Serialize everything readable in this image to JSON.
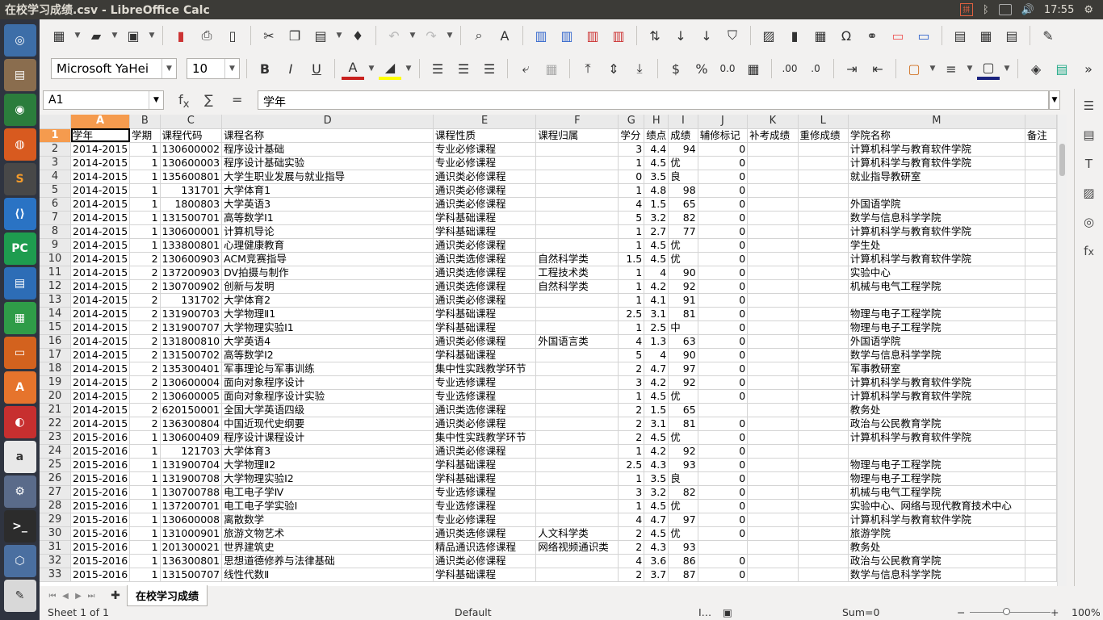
{
  "window": {
    "title": "在校学习成绩.csv - LibreOffice Calc"
  },
  "tray": {
    "time": "17:55"
  },
  "launcher": [
    "dash",
    "files",
    "chrome",
    "firefox",
    "sublime",
    "vscode",
    "pycharm",
    "writer",
    "calc",
    "impress",
    "software-center",
    "netease-music",
    "amazon",
    "settings",
    "terminal",
    "box",
    "editor"
  ],
  "toolbar2": {
    "font_name": "Microsoft YaHei",
    "font_size": "10"
  },
  "formula": {
    "cell_ref": "A1",
    "content": "学年"
  },
  "columns": [
    "A",
    "B",
    "C",
    "D",
    "E",
    "F",
    "G",
    "H",
    "I",
    "J",
    "K",
    "L",
    "M",
    ""
  ],
  "headers": [
    "学年",
    "学期",
    "课程代码",
    "课程名称",
    "课程性质",
    "课程归属",
    "学分",
    "绩点",
    "成绩",
    "辅修标记",
    "补考成绩",
    "重修成绩",
    "学院名称",
    "备注"
  ],
  "rows": [
    [
      "2014-2015",
      "1",
      "130600002",
      "程序设计基础",
      "专业必修课程",
      "",
      "3",
      "4.4",
      "94",
      "0",
      "",
      "",
      "计算机科学与教育软件学院",
      ""
    ],
    [
      "2014-2015",
      "1",
      "130600003",
      "程序设计基础实验",
      "专业必修课程",
      "",
      "1",
      "4.5",
      "优",
      "0",
      "",
      "",
      "计算机科学与教育软件学院",
      ""
    ],
    [
      "2014-2015",
      "1",
      "135600801",
      "大学生职业发展与就业指导",
      "通识类必修课程",
      "",
      "0",
      "3.5",
      "良",
      "0",
      "",
      "",
      "就业指导教研室",
      ""
    ],
    [
      "2014-2015",
      "1",
      "131701",
      "大学体育1",
      "通识类必修课程",
      "",
      "1",
      "4.8",
      "98",
      "0",
      "",
      "",
      "",
      ""
    ],
    [
      "2014-2015",
      "1",
      "1800803",
      "大学英语3",
      "通识类必修课程",
      "",
      "4",
      "1.5",
      "65",
      "0",
      "",
      "",
      "外国语学院",
      ""
    ],
    [
      "2014-2015",
      "1",
      "131500701",
      "高等数学Ⅰ1",
      "学科基础课程",
      "",
      "5",
      "3.2",
      "82",
      "0",
      "",
      "",
      "数学与信息科学学院",
      ""
    ],
    [
      "2014-2015",
      "1",
      "130600001",
      "计算机导论",
      "学科基础课程",
      "",
      "1",
      "2.7",
      "77",
      "0",
      "",
      "",
      "计算机科学与教育软件学院",
      ""
    ],
    [
      "2014-2015",
      "1",
      "133800801",
      "心理健康教育",
      "通识类必修课程",
      "",
      "1",
      "4.5",
      "优",
      "0",
      "",
      "",
      "学生处",
      ""
    ],
    [
      "2014-2015",
      "2",
      "130600903",
      "ACM竞赛指导",
      "通识类选修课程",
      "自然科学类",
      "1.5",
      "4.5",
      "优",
      "0",
      "",
      "",
      "计算机科学与教育软件学院",
      ""
    ],
    [
      "2014-2015",
      "2",
      "137200903",
      "DV拍摄与制作",
      "通识类选修课程",
      "工程技术类",
      "1",
      "4",
      "90",
      "0",
      "",
      "",
      "实验中心",
      ""
    ],
    [
      "2014-2015",
      "2",
      "130700902",
      "创新与发明",
      "通识类选修课程",
      "自然科学类",
      "1",
      "4.2",
      "92",
      "0",
      "",
      "",
      "机械与电气工程学院",
      ""
    ],
    [
      "2014-2015",
      "2",
      "131702",
      "大学体育2",
      "通识类必修课程",
      "",
      "1",
      "4.1",
      "91",
      "0",
      "",
      "",
      "",
      ""
    ],
    [
      "2014-2015",
      "2",
      "131900703",
      "大学物理Ⅱ1",
      "学科基础课程",
      "",
      "2.5",
      "3.1",
      "81",
      "0",
      "",
      "",
      "物理与电子工程学院",
      ""
    ],
    [
      "2014-2015",
      "2",
      "131900707",
      "大学物理实验Ⅰ1",
      "学科基础课程",
      "",
      "1",
      "2.5",
      "中",
      "0",
      "",
      "",
      "物理与电子工程学院",
      ""
    ],
    [
      "2014-2015",
      "2",
      "131800810",
      "大学英语4",
      "通识类必修课程",
      "外国语言类",
      "4",
      "1.3",
      "63",
      "0",
      "",
      "",
      "外国语学院",
      ""
    ],
    [
      "2014-2015",
      "2",
      "131500702",
      "高等数学Ⅰ2",
      "学科基础课程",
      "",
      "5",
      "4",
      "90",
      "0",
      "",
      "",
      "数学与信息科学学院",
      ""
    ],
    [
      "2014-2015",
      "2",
      "135300401",
      "军事理论与军事训练",
      "集中性实践教学环节",
      "",
      "2",
      "4.7",
      "97",
      "0",
      "",
      "",
      "军事教研室",
      ""
    ],
    [
      "2014-2015",
      "2",
      "130600004",
      "面向对象程序设计",
      "专业选修课程",
      "",
      "3",
      "4.2",
      "92",
      "0",
      "",
      "",
      "计算机科学与教育软件学院",
      ""
    ],
    [
      "2014-2015",
      "2",
      "130600005",
      "面向对象程序设计实验",
      "专业选修课程",
      "",
      "1",
      "4.5",
      "优",
      "0",
      "",
      "",
      "计算机科学与教育软件学院",
      ""
    ],
    [
      "2014-2015",
      "2",
      "620150001",
      "全国大学英语四级",
      "通识类选修课程",
      "",
      "2",
      "1.5",
      "65",
      "",
      "",
      "",
      "教务处",
      ""
    ],
    [
      "2014-2015",
      "2",
      "136300804",
      "中国近现代史纲要",
      "通识类必修课程",
      "",
      "2",
      "3.1",
      "81",
      "0",
      "",
      "",
      "政治与公民教育学院",
      ""
    ],
    [
      "2015-2016",
      "1",
      "130600409",
      "程序设计课程设计",
      "集中性实践教学环节",
      "",
      "2",
      "4.5",
      "优",
      "0",
      "",
      "",
      "计算机科学与教育软件学院",
      ""
    ],
    [
      "2015-2016",
      "1",
      "121703",
      "大学体育3",
      "通识类必修课程",
      "",
      "1",
      "4.2",
      "92",
      "0",
      "",
      "",
      "",
      ""
    ],
    [
      "2015-2016",
      "1",
      "131900704",
      "大学物理Ⅱ2",
      "学科基础课程",
      "",
      "2.5",
      "4.3",
      "93",
      "0",
      "",
      "",
      "物理与电子工程学院",
      ""
    ],
    [
      "2015-2016",
      "1",
      "131900708",
      "大学物理实验Ⅰ2",
      "学科基础课程",
      "",
      "1",
      "3.5",
      "良",
      "0",
      "",
      "",
      "物理与电子工程学院",
      ""
    ],
    [
      "2015-2016",
      "1",
      "130700788",
      "电工电子学Ⅳ",
      "专业选修课程",
      "",
      "3",
      "3.2",
      "82",
      "0",
      "",
      "",
      "机械与电气工程学院",
      ""
    ],
    [
      "2015-2016",
      "1",
      "137200701",
      "电工电子学实验Ⅰ",
      "专业选修课程",
      "",
      "1",
      "4.5",
      "优",
      "0",
      "",
      "",
      "实验中心、网络与现代教育技术中心",
      ""
    ],
    [
      "2015-2016",
      "1",
      "130600008",
      "离散数学",
      "专业必修课程",
      "",
      "4",
      "4.7",
      "97",
      "0",
      "",
      "",
      "计算机科学与教育软件学院",
      ""
    ],
    [
      "2015-2016",
      "1",
      "131000901",
      "旅游文物艺术",
      "通识类选修课程",
      "人文科学类",
      "2",
      "4.5",
      "优",
      "0",
      "",
      "",
      "旅游学院",
      ""
    ],
    [
      "2015-2016",
      "1",
      "201300021",
      "世界建筑史",
      "精品通识选修课程",
      "网络视频通识类",
      "2",
      "4.3",
      "93",
      "",
      "",
      "",
      "教务处",
      ""
    ],
    [
      "2015-2016",
      "1",
      "136300801",
      "思想道德修养与法律基础",
      "通识类必修课程",
      "",
      "4",
      "3.6",
      "86",
      "0",
      "",
      "",
      "政治与公民教育学院",
      ""
    ],
    [
      "2015-2016",
      "1",
      "131500707",
      "线性代数Ⅱ",
      "学科基础课程",
      "",
      "2",
      "3.7",
      "87",
      "0",
      "",
      "",
      "数学与信息科学学院",
      ""
    ]
  ],
  "sheet_tab": "在校学习成绩",
  "status": {
    "sheet": "Sheet 1 of 1",
    "style": "Default",
    "sum": "Sum=0",
    "zoom": "100%"
  }
}
